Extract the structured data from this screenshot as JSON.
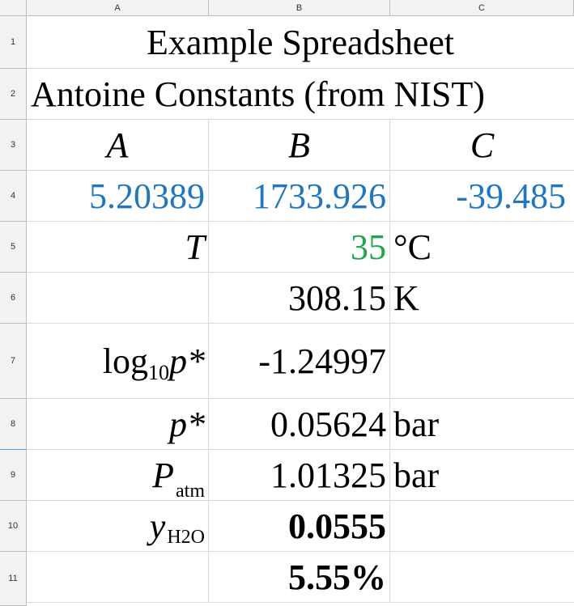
{
  "columns": [
    "A",
    "B",
    "C"
  ],
  "rows": [
    "1",
    "2",
    "3",
    "4",
    "5",
    "6",
    "7",
    "8",
    "9",
    "10",
    "11"
  ],
  "cells": {
    "title": "Example Spreadsheet",
    "subtitle": "Antoine Constants (from NIST)",
    "hdr_a": "A",
    "hdr_b": "B",
    "hdr_c": "C",
    "const_a": "5.20389",
    "const_b": "1733.926",
    "const_c": "-39.485",
    "t_label": "T",
    "t_value": "35",
    "t_unit": "°C",
    "t_kelvin": "308.15",
    "k_unit": "K",
    "logp_label_main": "log",
    "logp_label_sub": "10",
    "logp_label_var": "p*",
    "logp_value": "-1.24997",
    "pstar_label": "p*",
    "pstar_value": "0.05624",
    "pstar_unit": "bar",
    "patm_label_main": "P",
    "patm_label_sub": "atm",
    "patm_value": "1.01325",
    "patm_unit": "bar",
    "yh2o_label_main": "y",
    "yh2o_label_sub": "H2O",
    "yh2o_value": "0.0555",
    "pct_value": "5.55%"
  },
  "colors": {
    "constants": "#1f77c4",
    "input": "#1fa54b",
    "header_bg": "#f2f2f2",
    "grid": "#d9d9d9"
  }
}
